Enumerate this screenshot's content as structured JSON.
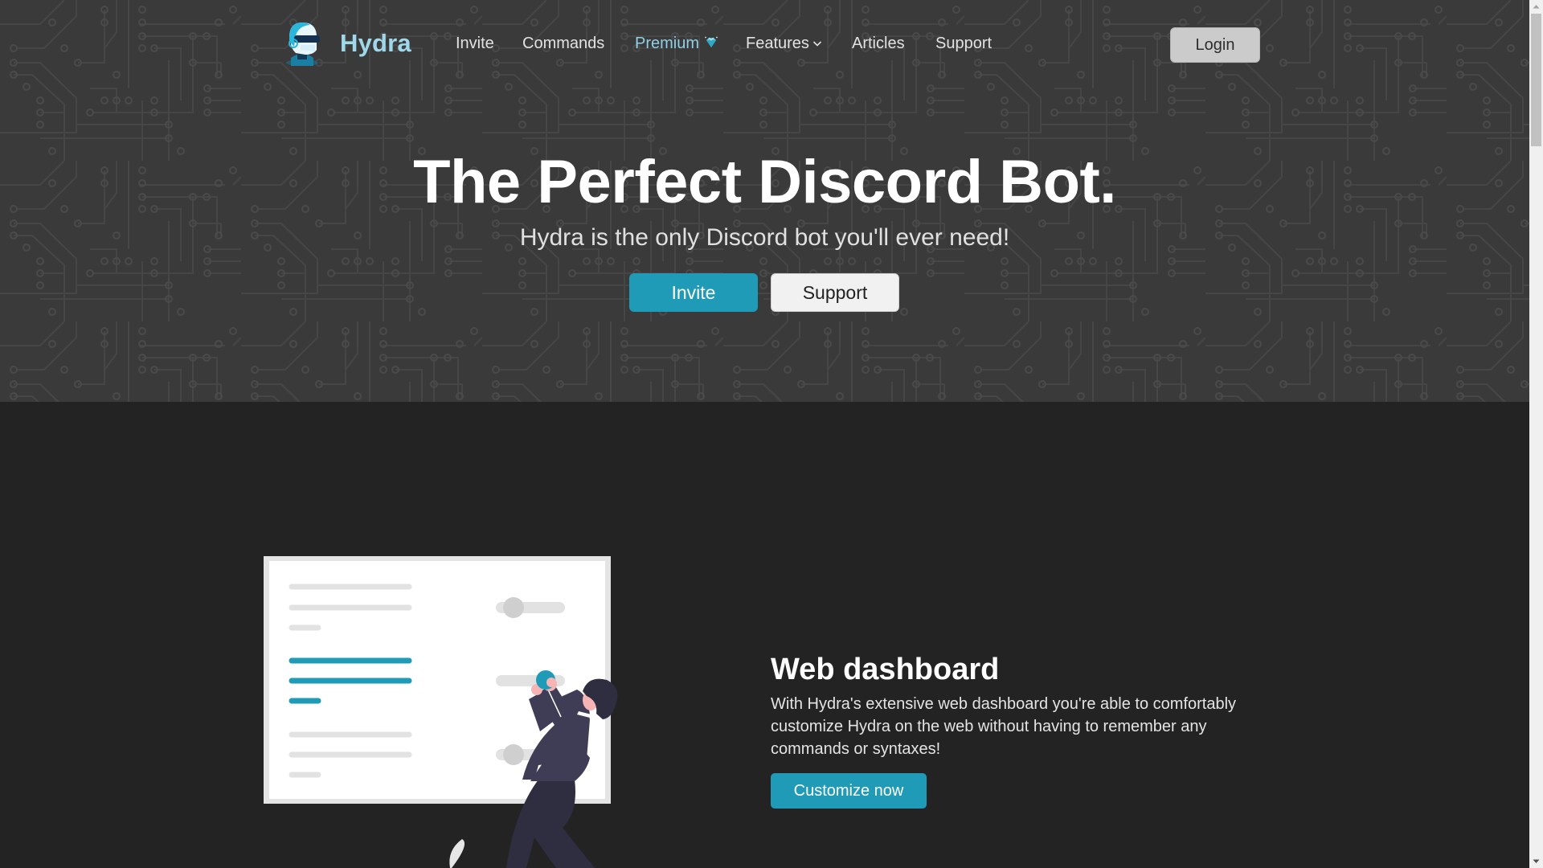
{
  "brand": {
    "name": "Hydra",
    "logo_icon": "robot-head-logo",
    "accent_color": "#1f9bb8",
    "brand_text_color": "#9fd8ea"
  },
  "nav": {
    "items": [
      {
        "label": "Invite"
      },
      {
        "label": "Commands"
      },
      {
        "label": "Premium",
        "icon": "diamond-icon",
        "highlighted": true
      },
      {
        "label": "Features",
        "icon": "chevron-down-icon",
        "dropdown": true
      },
      {
        "label": "Articles"
      },
      {
        "label": "Support"
      }
    ],
    "login_label": "Login"
  },
  "hero": {
    "title": "The Perfect Discord Bot.",
    "subtitle": "Hydra is the only Discord bot you'll ever need!",
    "primary_button": "Invite",
    "secondary_button": "Support",
    "background_pattern": "circuit-board"
  },
  "feature": {
    "title": "Web dashboard",
    "description": "With Hydra's extensive web dashboard you're able to comfortably customize Hydra on the web without having to remember any commands or syntaxes!",
    "button_label": "Customize now",
    "illustration": "person-adjusting-dashboard-toggles"
  },
  "scrollbar": {
    "position_fraction": 0.0
  }
}
